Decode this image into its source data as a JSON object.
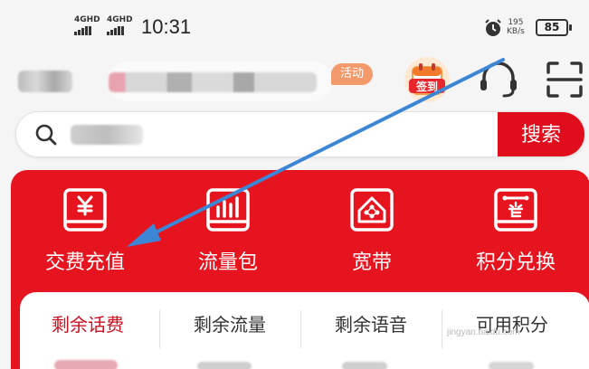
{
  "status_bar": {
    "signal1_label": "4GHD",
    "signal2_label": "4GHD",
    "time": "10:31",
    "speed_value": "195",
    "speed_unit": "KB/s",
    "battery": "85"
  },
  "header": {
    "activity_badge": "活动",
    "checkin_label": "签到",
    "icons": [
      "customer-service-icon",
      "scan-icon"
    ]
  },
  "search": {
    "button_label": "搜索"
  },
  "services": [
    {
      "label": "交费充值",
      "icon": "yuan-receipt-icon"
    },
    {
      "label": "流量包",
      "icon": "data-bars-icon"
    },
    {
      "label": "宽带",
      "icon": "broadband-house-icon"
    },
    {
      "label": "积分兑换",
      "icon": "points-card-icon"
    }
  ],
  "tabs": [
    {
      "label": "剩余话费",
      "active": true
    },
    {
      "label": "剩余流量",
      "active": false
    },
    {
      "label": "剩余语音",
      "active": false
    },
    {
      "label": "可用积分",
      "active": false
    }
  ],
  "colors": {
    "brand_red": "#e6141f",
    "search_button": "#e00d1d",
    "active_tab": "#c91322",
    "badge": "#f39a6c",
    "annotation_arrow": "#3d86d6"
  },
  "watermark": "jingyan.baidu.com"
}
